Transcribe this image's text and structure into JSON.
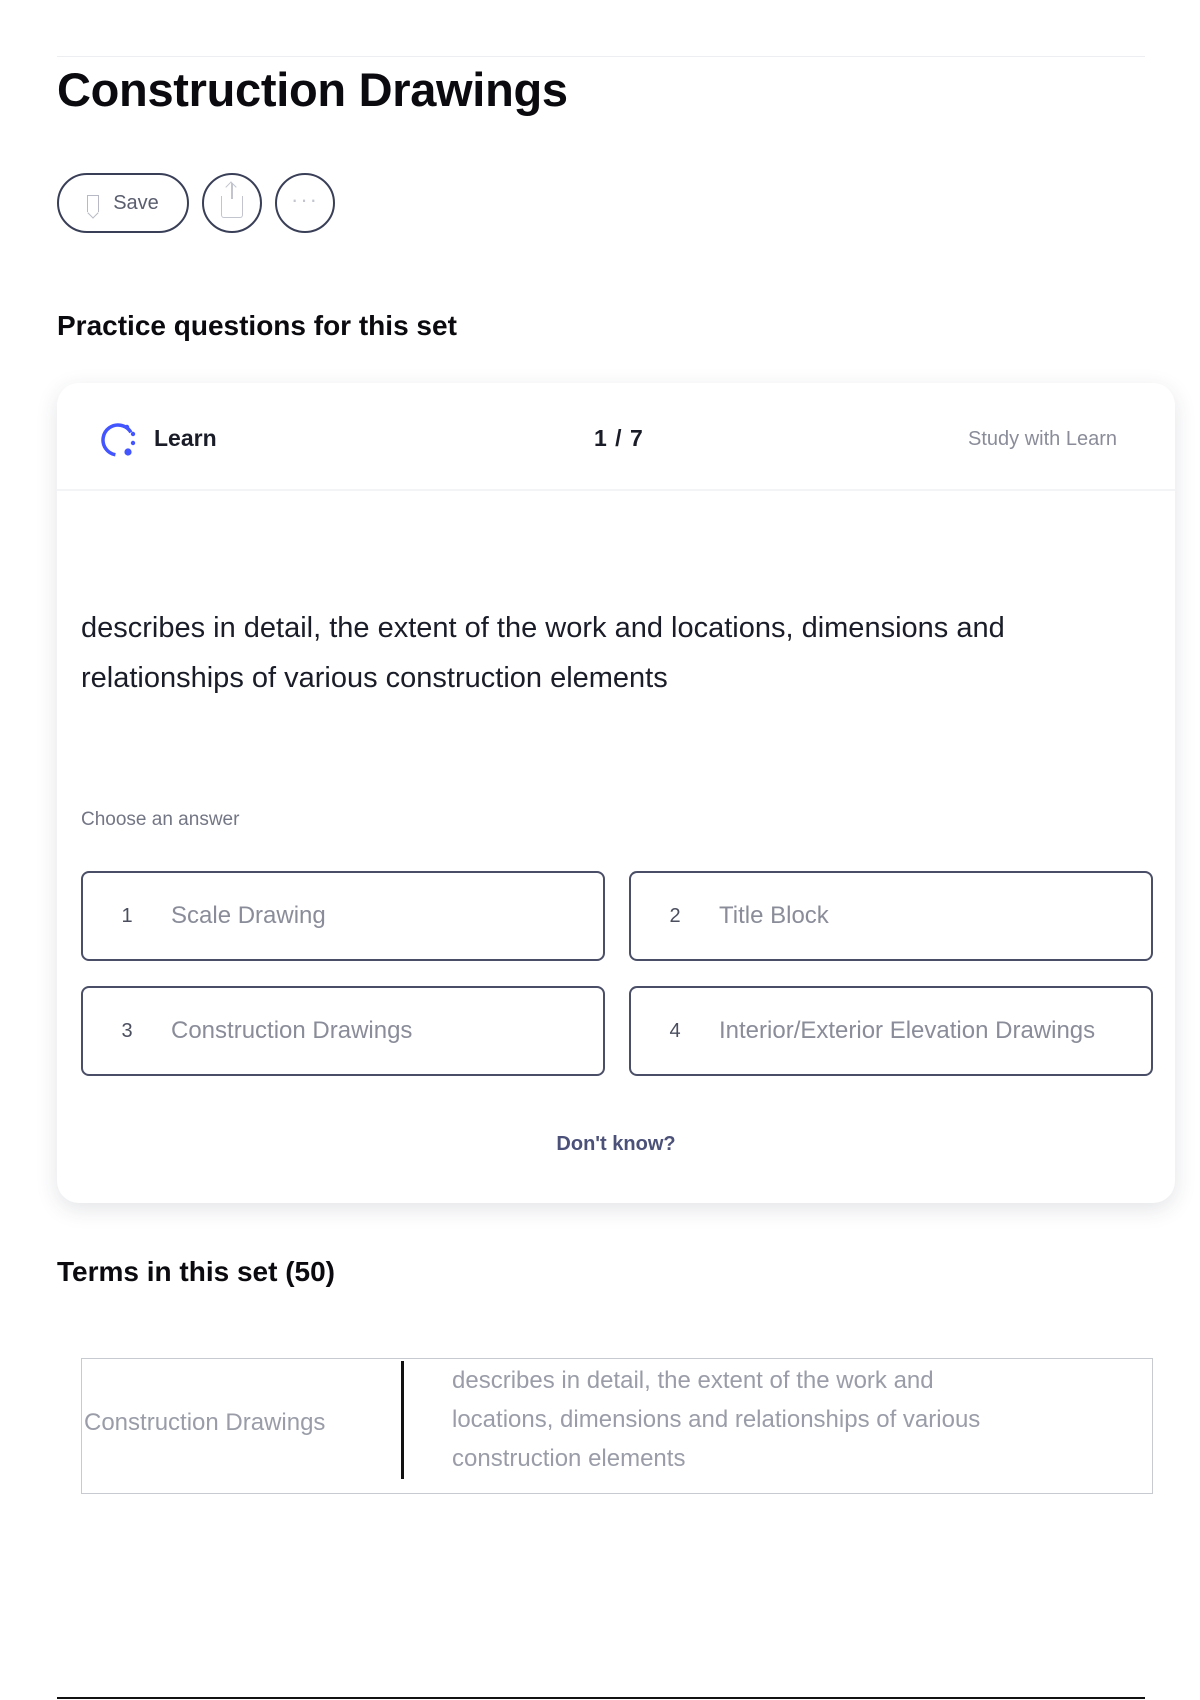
{
  "page": {
    "title": "Construction Drawings"
  },
  "actions": {
    "save_label": "Save",
    "share_icon": "share-icon",
    "more_icon": "more-icon"
  },
  "practice": {
    "heading": "Practice questions for this set",
    "learn_label": "Learn",
    "progress": "1 / 7",
    "study_link": "Study with Learn",
    "question": "describes in detail, the extent of the work and locations, dimensions and relationships of various construction elements",
    "choose_label": "Choose an answer",
    "answers": [
      {
        "number": "1",
        "text": "Scale Drawing"
      },
      {
        "number": "2",
        "text": "Title Block"
      },
      {
        "number": "3",
        "text": "Construction Drawings"
      },
      {
        "number": "4",
        "text": "Interior/Exterior Elevation Drawings"
      }
    ],
    "dont_know": "Don't know?"
  },
  "terms": {
    "heading": "Terms in this set (50)",
    "rows": [
      {
        "term": "Construction Drawings",
        "definition": "describes in detail, the extent of the work and locations, dimensions and relationships of various construction elements"
      }
    ]
  },
  "colors": {
    "accent": "#4255ff",
    "border": "#4a4f67",
    "muted_text": "#8a8d99"
  }
}
